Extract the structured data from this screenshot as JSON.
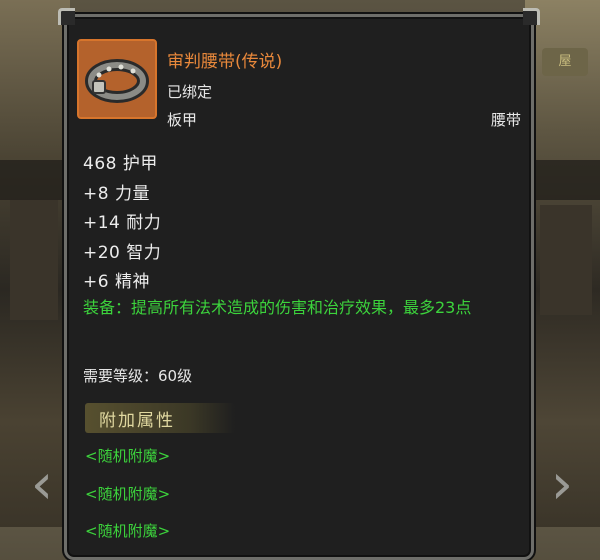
{
  "item": {
    "name": "审判腰带(传说)",
    "binding": "已绑定",
    "armor_type": "板甲",
    "slot": "腰带",
    "icon": "belt-icon",
    "name_color": "#e8883b"
  },
  "stats": [
    "468 护甲",
    "+8 力量",
    "+14 耐力",
    "+20 智力",
    "+6 精神"
  ],
  "equip_effect": "装备：提高所有法术造成的伤害和治疗效果，最多23点",
  "requirement": "需要等级：60级",
  "extra_attributes": {
    "header": "附加属性",
    "enchants": [
      "<随机附魔>",
      "<随机附魔>",
      "<随机附魔>"
    ]
  },
  "background": {
    "sign_text": "屋"
  },
  "colors": {
    "panel_bg": "#1f1f1f",
    "panel_border": "#6e6e6a",
    "legendary": "#e8883b",
    "green": "#3cd33c"
  }
}
